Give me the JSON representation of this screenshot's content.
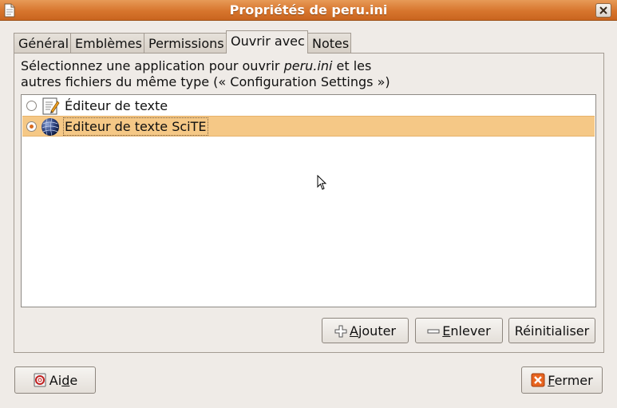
{
  "window": {
    "title": "Propriétés de peru.ini"
  },
  "tabs": [
    {
      "label": "Général"
    },
    {
      "label": "Emblèmes"
    },
    {
      "label": "Permissions"
    },
    {
      "label": "Ouvrir avec"
    },
    {
      "label": "Notes"
    }
  ],
  "active_tab": "Ouvrir avec",
  "description": {
    "line1_prefix": "Sélectionnez une application pour ouvrir ",
    "filename": "peru.ini",
    "line1_suffix": " et les",
    "line2": "autres fichiers du même type (« Configuration Settings »)"
  },
  "applications": [
    {
      "label": "Éditeur de texte",
      "icon": "text-editor-icon",
      "selected": false
    },
    {
      "label": "Editeur de texte SciTE",
      "icon": "scite-icon",
      "selected": true
    }
  ],
  "buttons": {
    "add": {
      "label_pre": "",
      "mnemonic": "A",
      "label_post": "jouter",
      "icon": "plus-icon"
    },
    "remove": {
      "label_pre": "",
      "mnemonic": "E",
      "label_post": "nlever",
      "icon": "minus-icon"
    },
    "reset": {
      "label": "Réinitialiser"
    },
    "help": {
      "label_pre": "Ai",
      "mnemonic": "d",
      "label_post": "e",
      "icon": "help-icon"
    },
    "close": {
      "label_pre": "",
      "mnemonic": "F",
      "label_post": "ermer",
      "icon": "close-icon"
    }
  },
  "colors": {
    "titlebar": "#d7752d",
    "selection": "#f5c886",
    "background": "#efebe7"
  }
}
